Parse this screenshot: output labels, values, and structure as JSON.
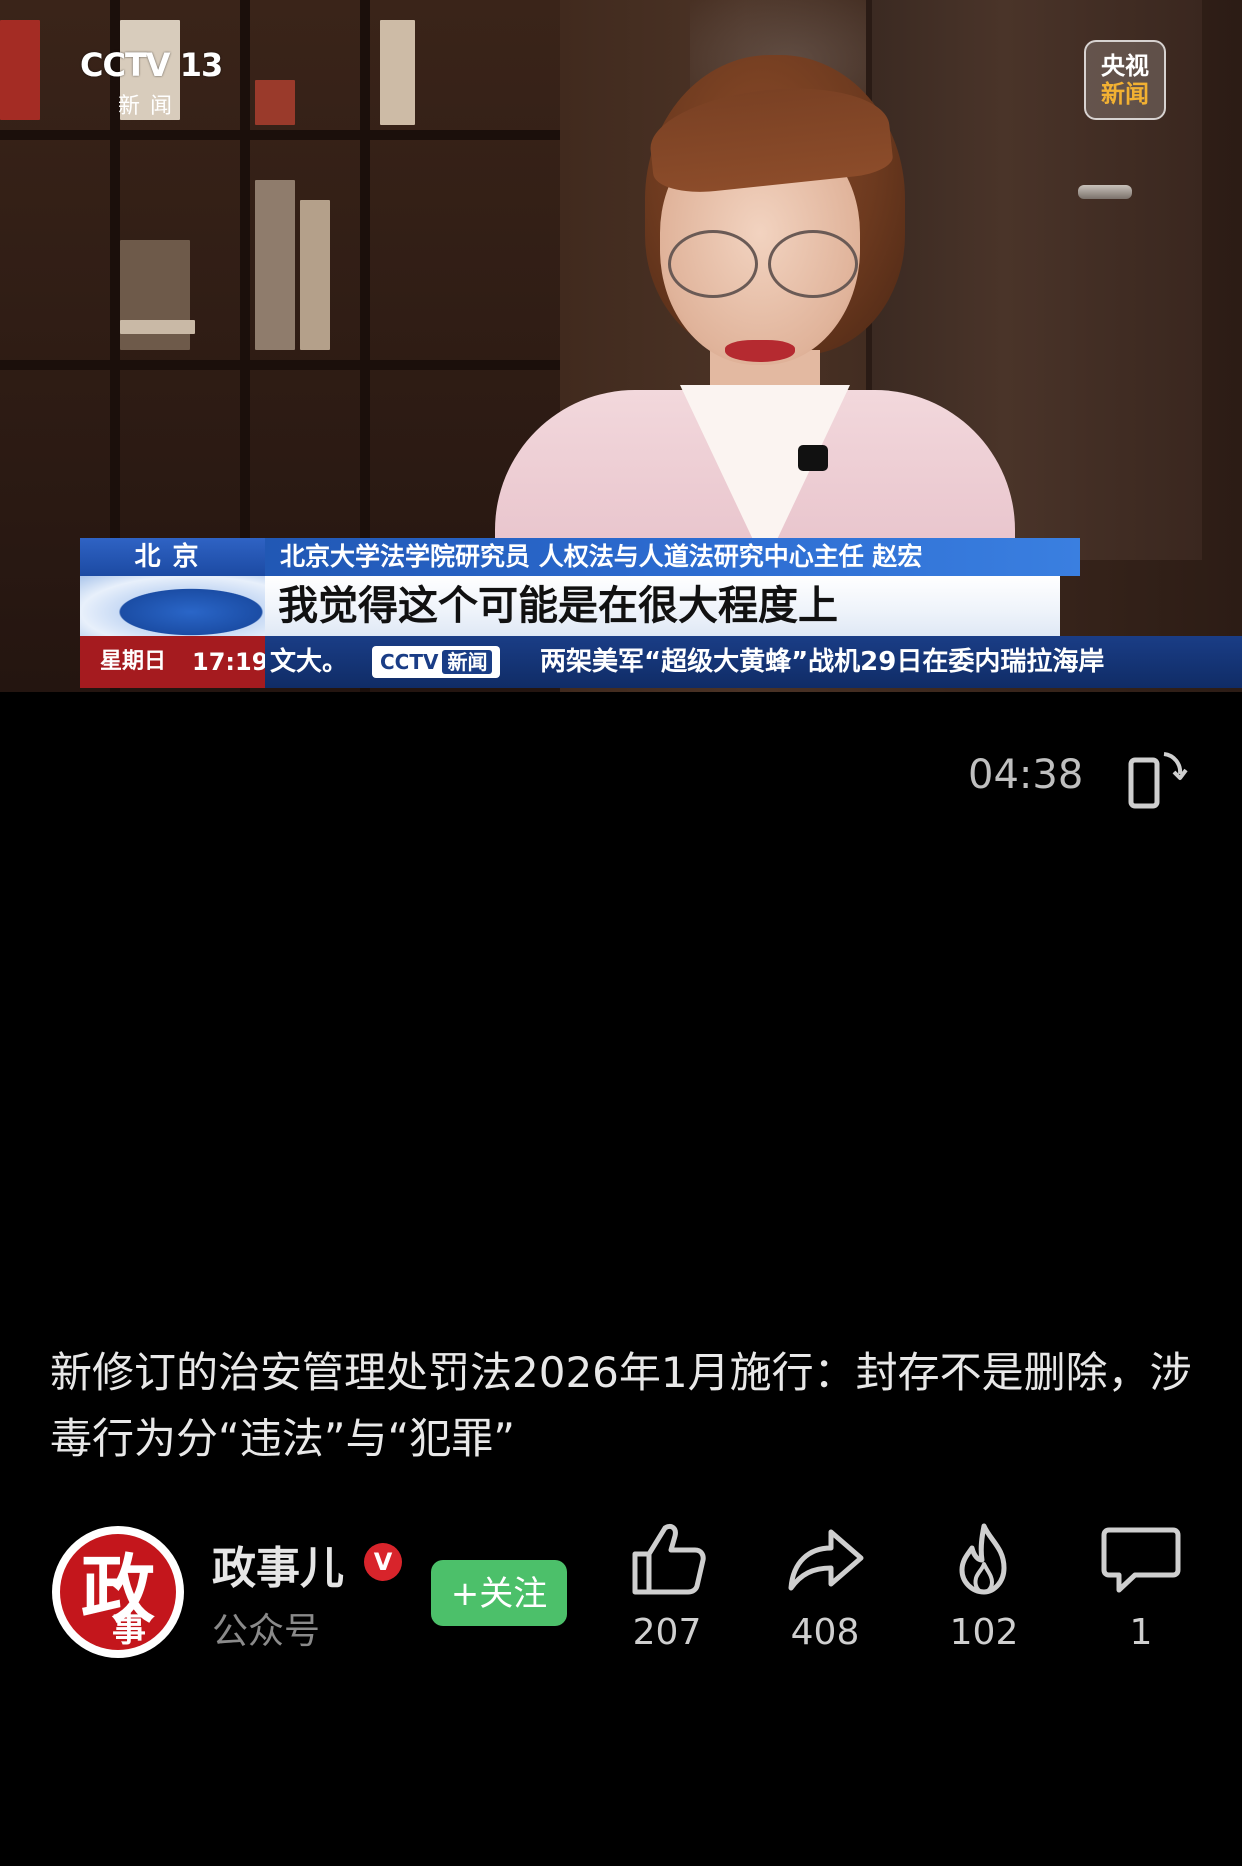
{
  "video": {
    "channel_logo": "CCTV 13",
    "channel_logo_sub": "新闻",
    "corner_logo_line1": "央视",
    "corner_logo_line2": "新闻",
    "location": "北京",
    "speaker_caption": "北京大学法学院研究员 人权法与人道法研究中心主任 赵宏",
    "subtitle": "我觉得这个可能是在很大程度上",
    "day": "星期日",
    "clock": "17:19",
    "ticker_prefix": "文大。",
    "ticker_logo": "CCTV",
    "ticker_logo_cn": "新闻",
    "ticker_headline": "两架美军“超级大黄蜂”战机29日在委内瑞拉海岸"
  },
  "controls": {
    "duration": "04:38",
    "rotate_icon": "rotate-screen-icon"
  },
  "article": {
    "title": "新修订的治安管理处罚法2026年1月施行：封存不是删除，涉毒行为分“违法”与“犯罪”"
  },
  "account": {
    "avatar_char1": "政",
    "avatar_char2": "事儿",
    "name": "政事儿",
    "verified_badge": "V",
    "type": "公众号",
    "follow_label": "+关注"
  },
  "actions": {
    "like_count": "207",
    "share_count": "408",
    "hot_count": "102",
    "comment_count": "1"
  },
  "colors": {
    "background": "#000000",
    "follow_green": "#4cc06a",
    "verified_red": "#d8242b",
    "banner_blue": "#1c4fa8",
    "ticker_red": "#a51b1f"
  }
}
